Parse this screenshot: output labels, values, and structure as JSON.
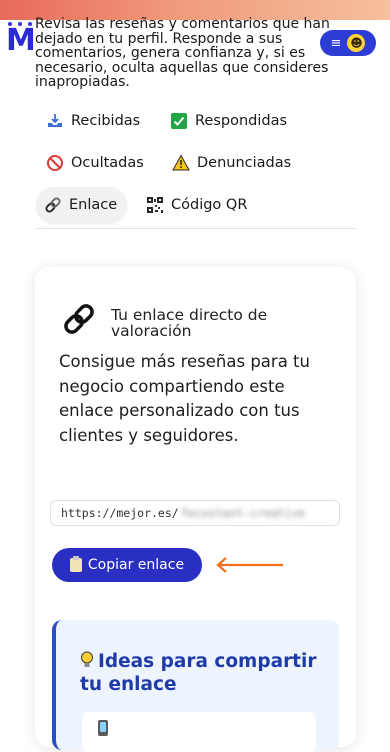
{
  "header": {
    "intro_text": "Revisa las reseñas y comentarios que han dejado en tu perfil. Responde a sus comentarios, genera confianza y, si es necesario, oculta aquellas que consideres inapropiadas.",
    "menu_icon": "hamburger-icon",
    "avatar_icon": "smiley-face-icon"
  },
  "tabs": [
    {
      "label": "Recibidas",
      "icon": "inbox-tray-icon"
    },
    {
      "label": "Respondidas",
      "icon": "check-mark-icon"
    },
    {
      "label": "Ocultadas",
      "icon": "prohibited-icon"
    },
    {
      "label": "Denunciadas",
      "icon": "warning-icon"
    },
    {
      "label": "Enlace",
      "icon": "link-icon",
      "active": true
    },
    {
      "label": "Código QR",
      "icon": "qr-code-icon"
    }
  ],
  "link_card": {
    "title": "Tu enlace directo de valoración",
    "description": "Consigue más reseñas para tu negocio compartiendo este enlace personalizado con tus clientes y seguidores.",
    "link_prefix": "https://mejor.es/",
    "link_blurred": "fecostant-creative",
    "copy_button_label": "Copiar enlace"
  },
  "ideas": {
    "title": "Ideas para compartir tu enlace"
  },
  "colors": {
    "primary": "#2a2fc4",
    "accent_arrow": "#f0701f",
    "ideas_bg": "#eef4fe"
  }
}
